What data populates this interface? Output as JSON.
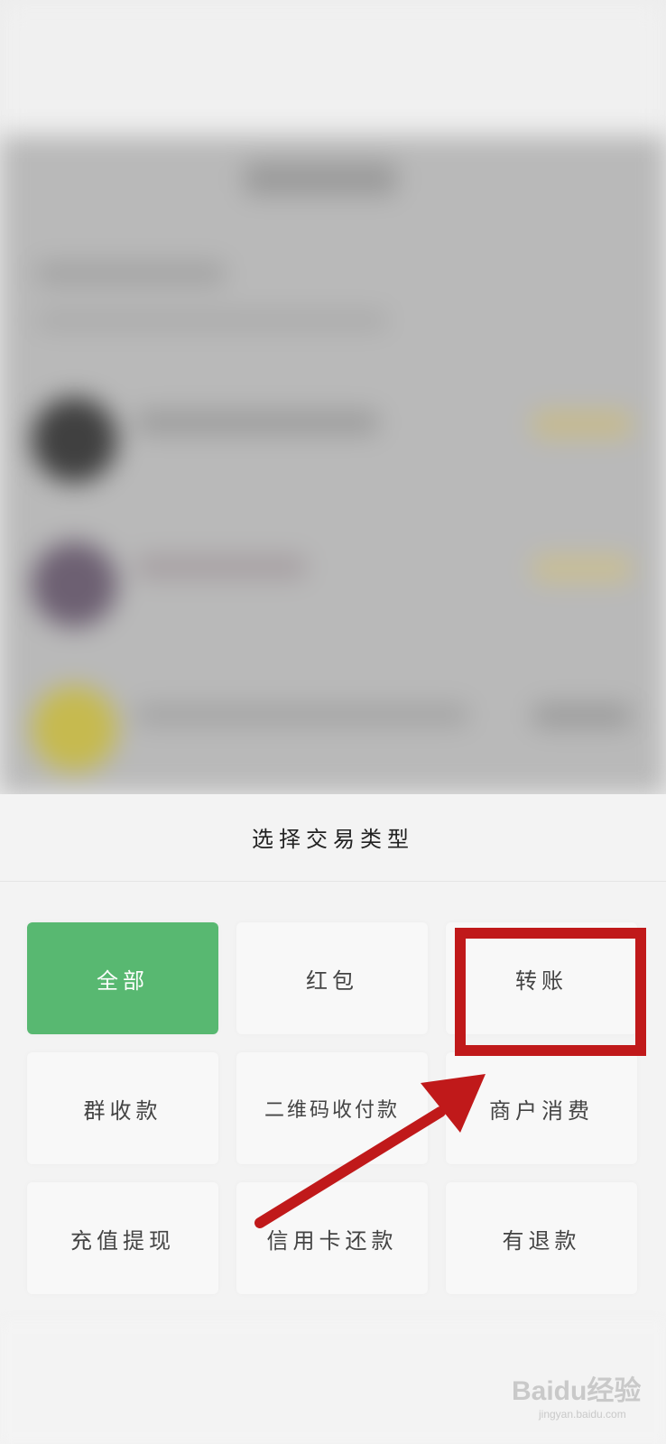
{
  "sheet": {
    "title": "选择交易类型",
    "options": [
      {
        "label": "全部",
        "selected": true
      },
      {
        "label": "红包",
        "selected": false
      },
      {
        "label": "转账",
        "selected": false
      },
      {
        "label": "群收款",
        "selected": false
      },
      {
        "label": "二维码收付款",
        "selected": false
      },
      {
        "label": "商户消费",
        "selected": false
      },
      {
        "label": "充值提现",
        "selected": false
      },
      {
        "label": "信用卡还款",
        "selected": false
      },
      {
        "label": "有退款",
        "selected": false
      }
    ]
  },
  "annotation": {
    "highlighted_option": "转账",
    "color": "#c0191a"
  },
  "watermark": {
    "main": "Baidu经验",
    "sub": "jingyan.baidu.com"
  },
  "colors": {
    "selected_bg": "#58b871",
    "sheet_bg": "#f3f3f3"
  }
}
